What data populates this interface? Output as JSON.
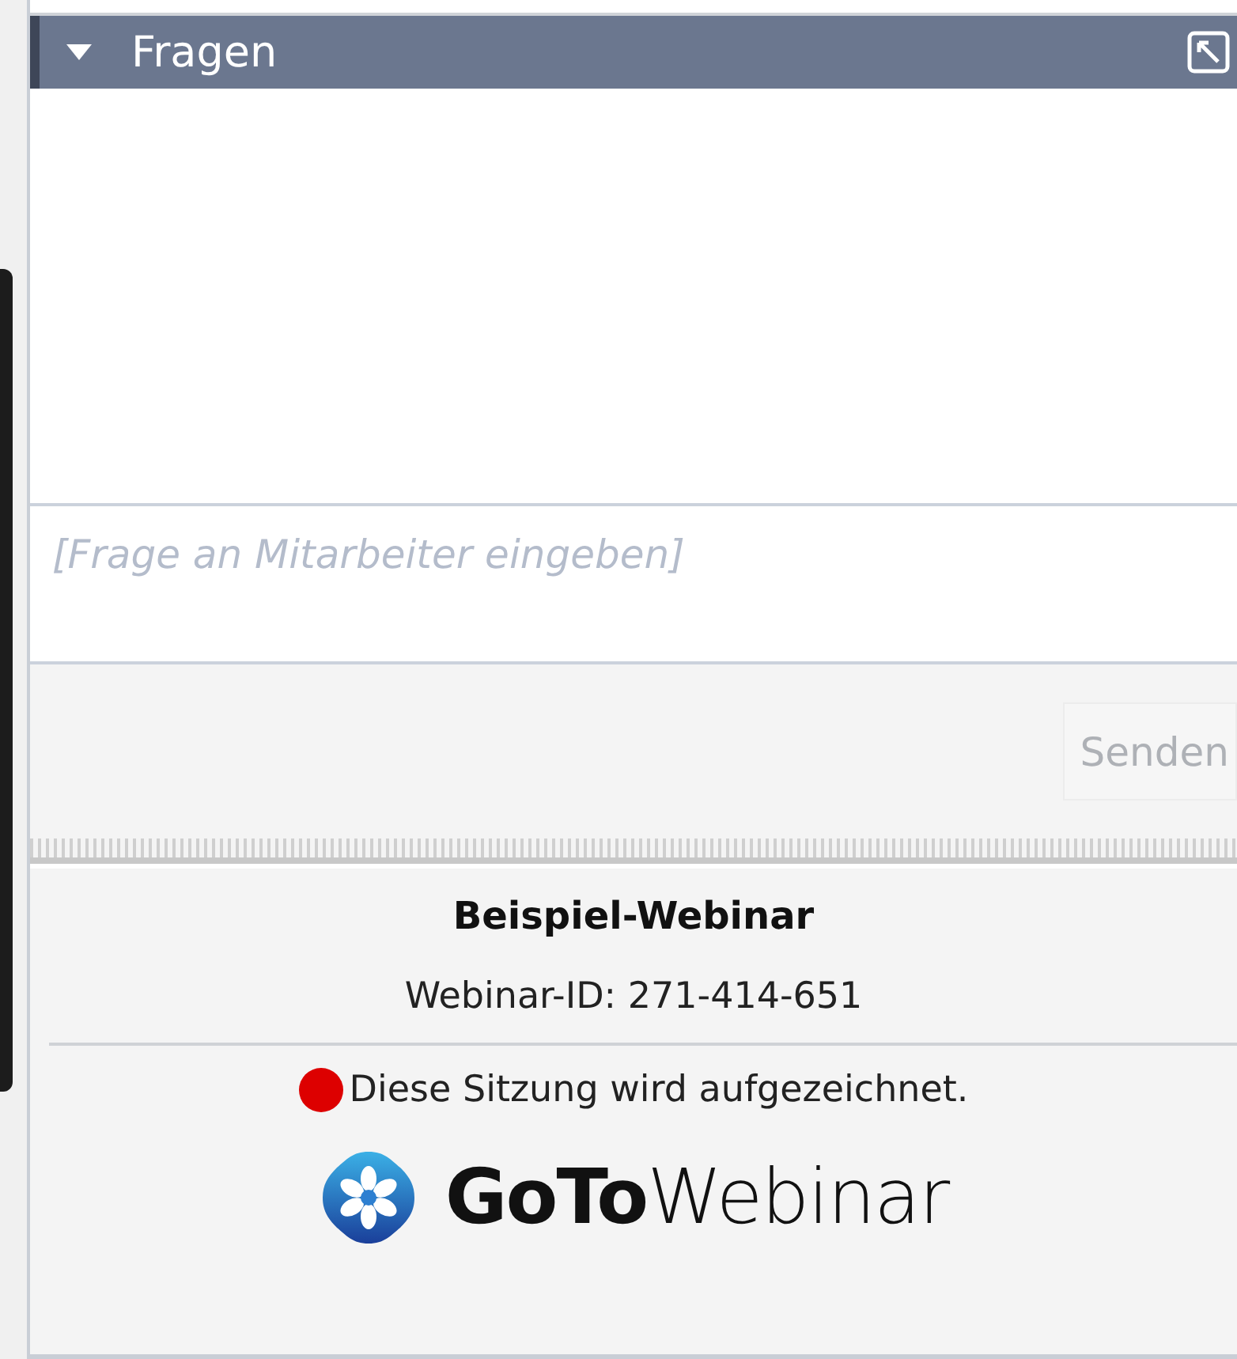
{
  "questions_panel": {
    "title": "Fragen",
    "expanded": true
  },
  "question_input": {
    "placeholder": "[Frage an Mitarbeiter eingeben]"
  },
  "send_button": {
    "label": "Senden",
    "disabled": true
  },
  "footer": {
    "webinar_title": "Beispiel-Webinar",
    "webinar_id": "Webinar-ID: 271-414-651",
    "recording": {
      "on": true,
      "text": "Diese Sitzung wird aufgezeichnet."
    },
    "logo": "**GoTo**Webinar"
  }
}
